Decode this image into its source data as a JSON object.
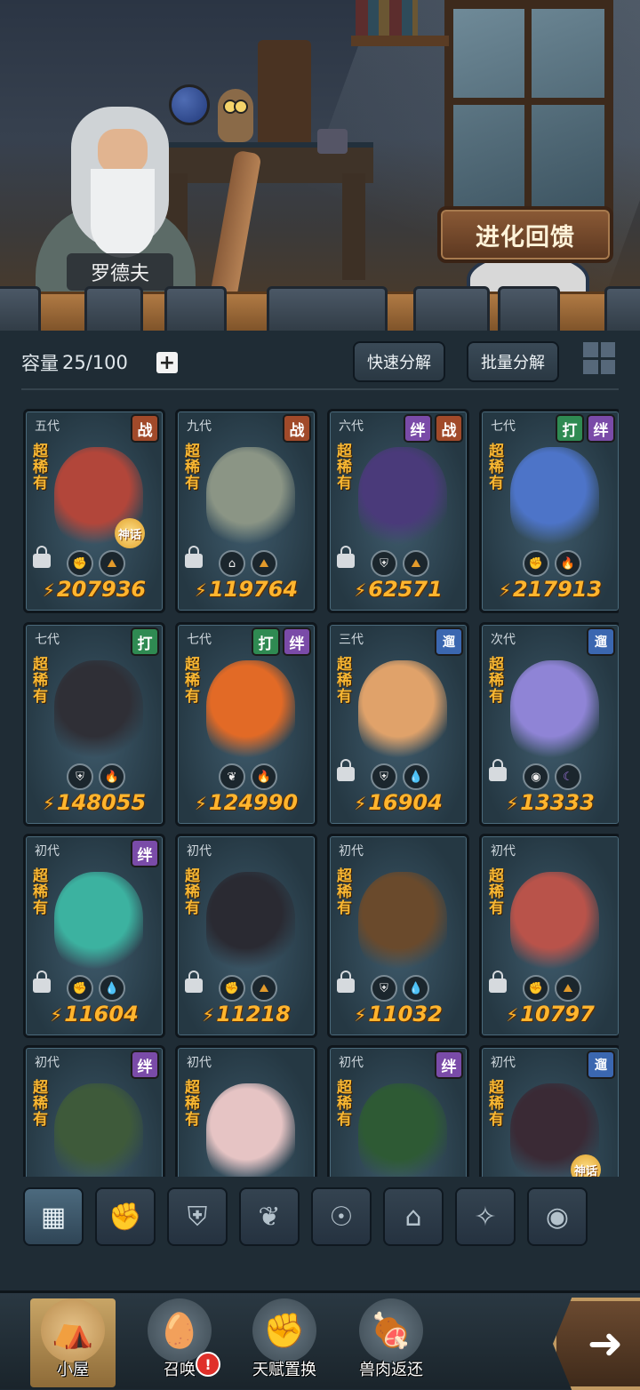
{
  "scene": {
    "npc_name": "罗德夫",
    "evolution_button": "进化回馈"
  },
  "toolbar": {
    "capacity_label": "容量",
    "capacity_value": "25/100",
    "plus_label": "+",
    "quick_decompose": "快速分解",
    "batch_decompose": "批量分解"
  },
  "rarity_text": "超稀有",
  "myth_badge": "神话",
  "power_icon": "⚡",
  "cards": [
    {
      "gen": "五代",
      "tags": [
        "战"
      ],
      "rare": true,
      "locked": true,
      "icons": [
        "fist-icon",
        "earth-icon"
      ],
      "power": "207936",
      "myth": true,
      "color": "#b2463a"
    },
    {
      "gen": "九代",
      "tags": [
        "战"
      ],
      "rare": true,
      "locked": true,
      "icons": [
        "helmet-icon",
        "earth-icon"
      ],
      "power": "119764",
      "myth": false,
      "color": "#8b9585"
    },
    {
      "gen": "六代",
      "tags": [
        "绊",
        "战"
      ],
      "rare": true,
      "locked": true,
      "icons": [
        "shield-icon",
        "earth-icon"
      ],
      "power": "62571",
      "myth": false,
      "color": "#4a3a7a"
    },
    {
      "gen": "七代",
      "tags": [
        "打",
        "绊"
      ],
      "rare": true,
      "locked": false,
      "icons": [
        "fist-icon",
        "fire-icon"
      ],
      "power": "217913",
      "myth": false,
      "color": "#4d74c8"
    },
    {
      "gen": "七代",
      "tags": [
        "打"
      ],
      "rare": true,
      "locked": false,
      "icons": [
        "shield-icon",
        "fire-icon"
      ],
      "power": "148055",
      "myth": false,
      "color": "#2f2f36"
    },
    {
      "gen": "七代",
      "tags": [
        "打",
        "绊"
      ],
      "rare": true,
      "locked": false,
      "icons": [
        "leaf-icon",
        "fire-icon"
      ],
      "power": "124990",
      "myth": false,
      "color": "#e26a26"
    },
    {
      "gen": "三代",
      "tags": [
        "遛"
      ],
      "rare": true,
      "locked": true,
      "icons": [
        "shield-icon",
        "water-icon"
      ],
      "power": "16904",
      "myth": false,
      "color": "#e0a26a"
    },
    {
      "gen": "次代",
      "tags": [
        "遛"
      ],
      "rare": true,
      "locked": true,
      "icons": [
        "eye-icon",
        "dark-icon"
      ],
      "power": "13333",
      "myth": false,
      "color": "#8f84d6"
    },
    {
      "gen": "初代",
      "tags": [
        "绊"
      ],
      "rare": true,
      "locked": true,
      "icons": [
        "fist-icon",
        "water-icon"
      ],
      "power": "11604",
      "myth": false,
      "color": "#3cb2a0"
    },
    {
      "gen": "初代",
      "tags": [],
      "rare": true,
      "locked": true,
      "icons": [
        "fist-icon",
        "earth-icon"
      ],
      "power": "11218",
      "myth": false,
      "color": "#2a2a32"
    },
    {
      "gen": "初代",
      "tags": [],
      "rare": true,
      "locked": true,
      "icons": [
        "shield-icon",
        "water-icon"
      ],
      "power": "11032",
      "myth": false,
      "color": "#6a4a2c"
    },
    {
      "gen": "初代",
      "tags": [],
      "rare": true,
      "locked": true,
      "icons": [
        "fist-icon",
        "earth-icon"
      ],
      "power": "10797",
      "myth": false,
      "color": "#b9534a"
    },
    {
      "gen": "初代",
      "tags": [
        "绊"
      ],
      "rare": true,
      "locked": false,
      "icons": [],
      "power": "",
      "myth": false,
      "color": "#3e5a3a"
    },
    {
      "gen": "初代",
      "tags": [],
      "rare": true,
      "locked": false,
      "icons": [],
      "power": "",
      "myth": false,
      "color": "#e6c4c4"
    },
    {
      "gen": "初代",
      "tags": [
        "绊"
      ],
      "rare": true,
      "locked": false,
      "icons": [],
      "power": "",
      "myth": false,
      "color": "#2e5a34"
    },
    {
      "gen": "初代",
      "tags": [
        "遛"
      ],
      "rare": true,
      "locked": false,
      "icons": [],
      "power": "",
      "myth": true,
      "color": "#3a2a35"
    }
  ],
  "filters": [
    {
      "name": "filter-all-icon",
      "glyph": "▦",
      "active": true
    },
    {
      "name": "filter-fist-icon",
      "glyph": "✊",
      "active": false
    },
    {
      "name": "filter-shield-icon",
      "glyph": "⛨",
      "active": false
    },
    {
      "name": "filter-leaf-icon",
      "glyph": "❦",
      "active": false
    },
    {
      "name": "filter-alien-icon",
      "glyph": "☉",
      "active": false
    },
    {
      "name": "filter-helmet-icon",
      "glyph": "⌂",
      "active": false
    },
    {
      "name": "filter-crosshair-icon",
      "glyph": "✧",
      "active": false
    },
    {
      "name": "filter-eye-icon",
      "glyph": "◉",
      "active": false
    }
  ],
  "nav": [
    {
      "label": "小屋",
      "name": "nav-hut",
      "glyph": "⛺",
      "active": true,
      "alert": false
    },
    {
      "label": "召唤",
      "name": "nav-summon",
      "glyph": "🥚",
      "active": false,
      "alert": true
    },
    {
      "label": "天赋置换",
      "name": "nav-talent",
      "glyph": "✊",
      "active": false,
      "alert": false
    },
    {
      "label": "兽肉返还",
      "name": "nav-meat",
      "glyph": "🍖",
      "active": false,
      "alert": false
    }
  ],
  "alert_mark": "!",
  "next_arrow": "➜"
}
